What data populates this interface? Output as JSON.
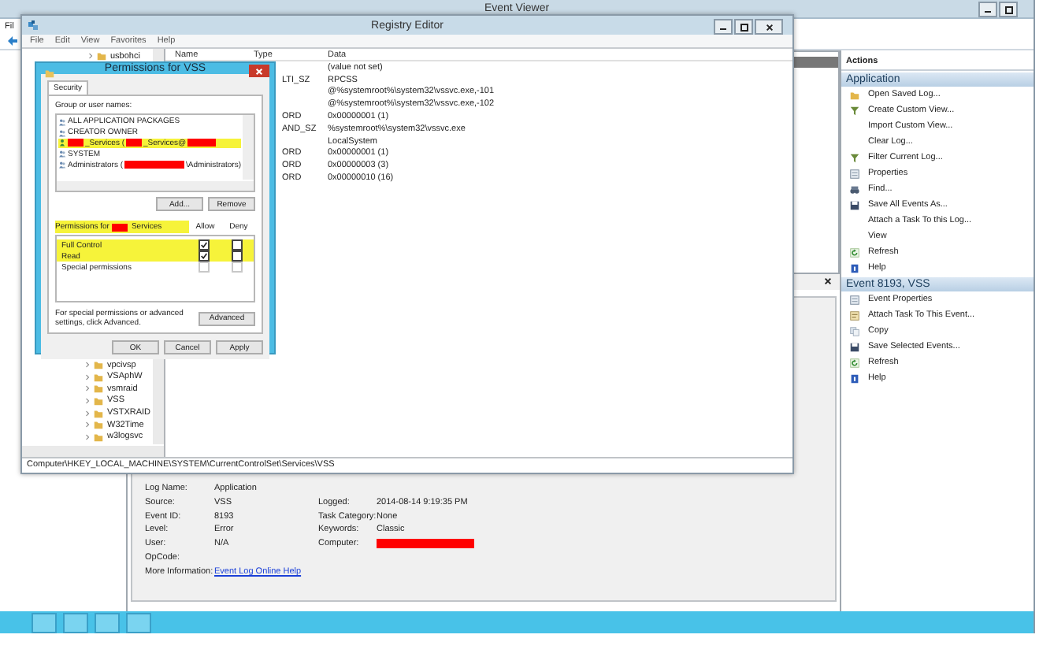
{
  "event_viewer": {
    "title": "Event Viewer",
    "menu": [
      "Fil"
    ],
    "actions": {
      "header": "Actions",
      "sections": [
        {
          "title": "Application",
          "items": [
            {
              "label": "Open Saved Log...",
              "kind": "folder"
            },
            {
              "label": "Create Custom View...",
              "kind": "filter"
            },
            {
              "label": "Import Custom View...",
              "kind": "plain"
            },
            {
              "label": "Clear Log...",
              "kind": "plain"
            },
            {
              "label": "Filter Current Log...",
              "kind": "filter"
            },
            {
              "label": "Properties",
              "kind": "properties"
            },
            {
              "label": "Find...",
              "kind": "find"
            },
            {
              "label": "Save All Events As...",
              "kind": "save"
            },
            {
              "label": "Attach a Task To this Log...",
              "kind": "plain"
            },
            {
              "label": "View",
              "kind": "plain"
            },
            {
              "label": "Refresh",
              "kind": "refresh"
            },
            {
              "label": "Help",
              "kind": "help"
            }
          ]
        },
        {
          "title": "Event 8193, VSS",
          "items": [
            {
              "label": "Event Properties",
              "kind": "properties"
            },
            {
              "label": "Attach Task To This Event...",
              "kind": "task"
            },
            {
              "label": "Copy",
              "kind": "copy"
            },
            {
              "label": "Save Selected Events...",
              "kind": "save"
            },
            {
              "label": "Refresh",
              "kind": "refresh"
            },
            {
              "label": "Help",
              "kind": "help"
            }
          ]
        }
      ]
    },
    "details": {
      "rows": [
        {
          "cells": [
            {
              "label": "Log Name:",
              "value": "Application"
            }
          ]
        },
        {
          "cells": [
            {
              "label": "Source:",
              "value": "VSS"
            },
            {
              "label": "Logged:",
              "value": "2014-08-14 9:19:35 PM"
            }
          ]
        },
        {
          "cells": [
            {
              "label": "Event ID:",
              "value": "8193"
            },
            {
              "label": "Task Category:",
              "value": "None"
            }
          ]
        },
        {
          "cells": [
            {
              "label": "Level:",
              "value": "Error"
            },
            {
              "label": "Keywords:",
              "value": "Classic"
            }
          ]
        },
        {
          "cells": [
            {
              "label": "User:",
              "value": "N/A"
            },
            {
              "label": "Computer:",
              "redacted": true
            }
          ]
        },
        {
          "cells": [
            {
              "label": "OpCode:"
            }
          ]
        },
        {
          "cells": [
            {
              "label": "More Information:",
              "link": "Event Log Online Help"
            }
          ]
        }
      ]
    }
  },
  "registry_editor": {
    "title": "Registry Editor",
    "menu": [
      "File",
      "Edit",
      "View",
      "Favorites",
      "Help"
    ],
    "tree_top": [
      {
        "label": "usbohci"
      }
    ],
    "tree_bottom": [
      {
        "label": "vpcivsp"
      },
      {
        "label": "VSAphW"
      },
      {
        "label": "vsmraid"
      },
      {
        "label": "VSS"
      },
      {
        "label": "VSTXRAID"
      },
      {
        "label": "W32Time"
      },
      {
        "label": "w3logsvc"
      }
    ],
    "columns": [
      "Name",
      "Type",
      "Data"
    ],
    "rows": [
      {
        "data": "(value not set)"
      },
      {
        "type": "LTI_SZ",
        "data": "RPCSS"
      },
      {
        "data": "@%systemroot%\\system32\\vssvc.exe,-101"
      },
      {
        "data": "@%systemroot%\\system32\\vssvc.exe,-102"
      },
      {
        "type": "ORD",
        "data": "0x00000001 (1)"
      },
      {
        "type": "AND_SZ",
        "data": "%systemroot%\\system32\\vssvc.exe"
      },
      {
        "data": "LocalSystem"
      },
      {
        "type": "ORD",
        "data": "0x00000001 (1)"
      },
      {
        "type": "ORD",
        "data": "0x00000003 (3)"
      },
      {
        "type": "ORD",
        "data": "0x00000010 (16)"
      }
    ],
    "status_bar": "Computer\\HKEY_LOCAL_MACHINE\\SYSTEM\\CurrentControlSet\\Services\\VSS"
  },
  "permissions_dialog": {
    "title": "Permissions for VSS",
    "tabs": [
      {
        "label": "Security",
        "selected": true
      }
    ],
    "group_label": "Group or user names:",
    "users": [
      {
        "kind": "group",
        "highlighted": false,
        "segments": [
          {
            "kind": "text",
            "text": "ALL APPLICATION PACKAGES"
          }
        ]
      },
      {
        "kind": "group",
        "highlighted": false,
        "segments": [
          {
            "kind": "text",
            "text": "CREATOR OWNER"
          }
        ]
      },
      {
        "kind": "user",
        "highlighted": true,
        "segments": [
          {
            "kind": "redaction"
          },
          {
            "kind": "text",
            "text": "_Services ("
          },
          {
            "kind": "redaction"
          },
          {
            "kind": "text",
            "text": "_Services@"
          },
          {
            "kind": "redaction"
          }
        ]
      },
      {
        "kind": "group",
        "highlighted": false,
        "segments": [
          {
            "kind": "text",
            "text": "SYSTEM"
          }
        ]
      },
      {
        "kind": "group",
        "highlighted": false,
        "segments": [
          {
            "kind": "text",
            "text": "Administrators ("
          },
          {
            "kind": "redaction"
          },
          {
            "kind": "text",
            "text": "\\Administrators)"
          }
        ]
      }
    ],
    "buttons_top": [
      "Add...",
      "Remove"
    ],
    "permissions_label": {
      "highlighted": true,
      "segments": [
        {
          "kind": "text",
          "text": "Permissions for"
        },
        {
          "kind": "redaction"
        },
        {
          "kind": "text",
          "text": "Services"
        }
      ]
    },
    "allow_label": "Allow",
    "deny_label": "Deny",
    "permissions": [
      {
        "name": "Full Control",
        "highlighted": true,
        "allow": {
          "checked": true,
          "disabled": false
        },
        "deny": {
          "checked": false,
          "disabled": false
        }
      },
      {
        "name": "Read",
        "highlighted": true,
        "allow": {
          "checked": true,
          "disabled": false
        },
        "deny": {
          "checked": false,
          "disabled": false
        }
      },
      {
        "name": "Special permissions",
        "highlighted": false,
        "allow": {
          "checked": false,
          "disabled": true
        },
        "deny": {
          "checked": false,
          "disabled": true
        }
      }
    ],
    "advanced_note": "For special permissions or advanced settings, click Advanced.",
    "advanced_button": "Advanced",
    "buttons": [
      "OK",
      "Cancel",
      "Apply"
    ]
  }
}
